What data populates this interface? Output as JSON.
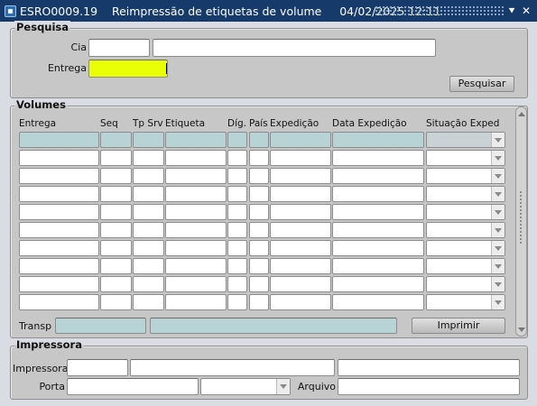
{
  "window": {
    "title": "ESRO0009.19    Reimpressão de etiquetas de volume     04/02/2025 12:11",
    "icon": "app-icon",
    "minimize_glyph": "⯆",
    "close_glyph": "✕"
  },
  "pesquisa": {
    "title": "Pesquisa",
    "cia_label": "Cia",
    "cia_code": "",
    "cia_name": "",
    "entrega_label": "Entrega",
    "entrega_value": "",
    "search_button": "Pesquisar"
  },
  "volumes": {
    "title": "Volumes",
    "columns": [
      "Entrega",
      "Seq",
      "Tp Srv",
      "Etiqueta",
      "Díg.",
      "País",
      "Expedição",
      "Data Expedição",
      "Situação Exped"
    ],
    "row_count": 10,
    "transp_label": "Transp",
    "transp_code": "",
    "transp_name": "",
    "print_button": "Imprimir"
  },
  "impressora": {
    "title": "Impressora",
    "impressora_label": "Impressora",
    "porta_label": "Porta",
    "arquivo_label": "Arquivo"
  },
  "colors": {
    "titlebar": "#163a6a",
    "frame_bg": "#c7c7c7",
    "highlight_field": "#e8ff06",
    "teal_field": "#b7d3d5"
  }
}
